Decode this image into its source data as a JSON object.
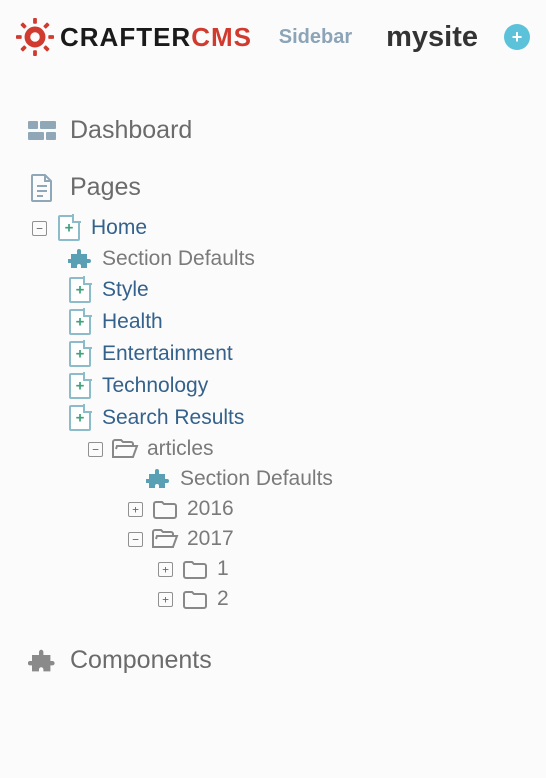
{
  "header": {
    "logo_prefix": "CRAFTER",
    "logo_suffix": "CMS",
    "sidebar_label": "Sidebar",
    "site_name": "mysite",
    "add_glyph": "+"
  },
  "sections": {
    "dashboard": "Dashboard",
    "pages": "Pages",
    "components": "Components"
  },
  "tree": {
    "home": "Home",
    "section_defaults": "Section Defaults",
    "style": "Style",
    "health": "Health",
    "entertainment": "Entertainment",
    "technology": "Technology",
    "search_results": "Search Results",
    "articles": "articles",
    "articles_section_defaults": "Section Defaults",
    "y2016": "2016",
    "y2017": "2017",
    "m1": "1",
    "m2": "2"
  },
  "toggles": {
    "minus": "−",
    "plus": "+"
  }
}
